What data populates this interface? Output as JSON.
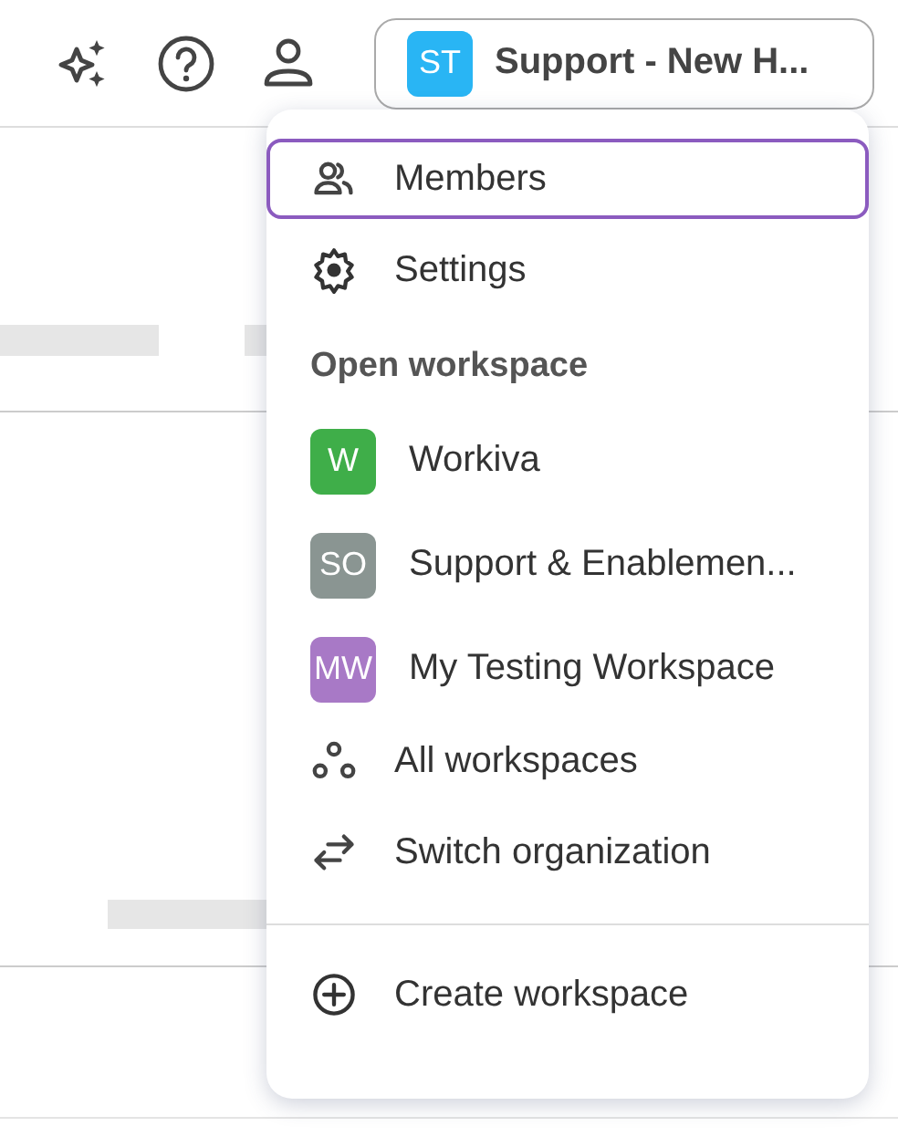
{
  "header": {
    "workspace_button": {
      "initials": "ST",
      "color": "#29b5f4",
      "label": "Support - New H..."
    }
  },
  "menu": {
    "items": [
      {
        "kind": "action",
        "label": "Members",
        "selected": true
      },
      {
        "kind": "action",
        "label": "Settings",
        "selected": false
      },
      {
        "kind": "heading",
        "label": "Open workspace"
      },
      {
        "kind": "workspace",
        "initials": "W",
        "label": "Workiva",
        "color": "#3fae49",
        "selected": false
      },
      {
        "kind": "workspace",
        "initials": "SO",
        "label": "Support & Enablemen...",
        "color": "#8a9592",
        "selected": false
      },
      {
        "kind": "workspace",
        "initials": "MW",
        "label": "My Testing Workspace",
        "color": "#a879c6",
        "selected": false
      },
      {
        "kind": "action",
        "label": "All workspaces",
        "selected": false
      },
      {
        "kind": "action",
        "label": "Switch organization",
        "selected": false
      },
      {
        "kind": "divider"
      },
      {
        "kind": "action",
        "label": "Create workspace",
        "selected": false
      }
    ]
  }
}
